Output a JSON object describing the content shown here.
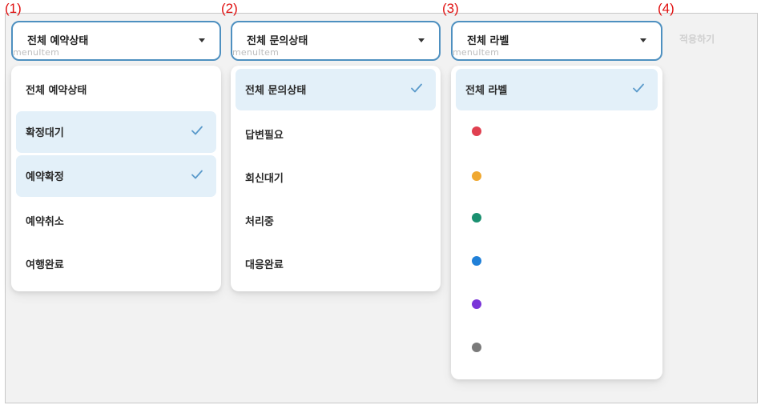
{
  "markers": [
    "(1)",
    "(2)",
    "(3)",
    "(4)"
  ],
  "ghost_text": "menuItem",
  "reservation": {
    "selected_label": "전체 예약상태",
    "options": [
      {
        "label": "전체 예약상태",
        "selected": false
      },
      {
        "label": "확정대기",
        "selected": true
      },
      {
        "label": "예약확정",
        "selected": true
      },
      {
        "label": "예약취소",
        "selected": false
      },
      {
        "label": "여행완료",
        "selected": false
      }
    ]
  },
  "inquiry": {
    "selected_label": "전체 문의상태",
    "options": [
      {
        "label": "전체 문의상태",
        "selected": true
      },
      {
        "label": "답변필요",
        "selected": false
      },
      {
        "label": "회신대기",
        "selected": false
      },
      {
        "label": "처리중",
        "selected": false
      },
      {
        "label": "대응완료",
        "selected": false
      }
    ]
  },
  "label": {
    "selected_label": "전체 라벨",
    "options": [
      {
        "label": "전체 라벨",
        "selected": true
      }
    ],
    "colors": [
      "#e04050",
      "#f0a830",
      "#1a9070",
      "#2080d8",
      "#7a35d8",
      "#7a7a7a"
    ]
  },
  "apply_button": "적용하기",
  "accent": "#4e90c0",
  "check_color": "#5a9acb"
}
